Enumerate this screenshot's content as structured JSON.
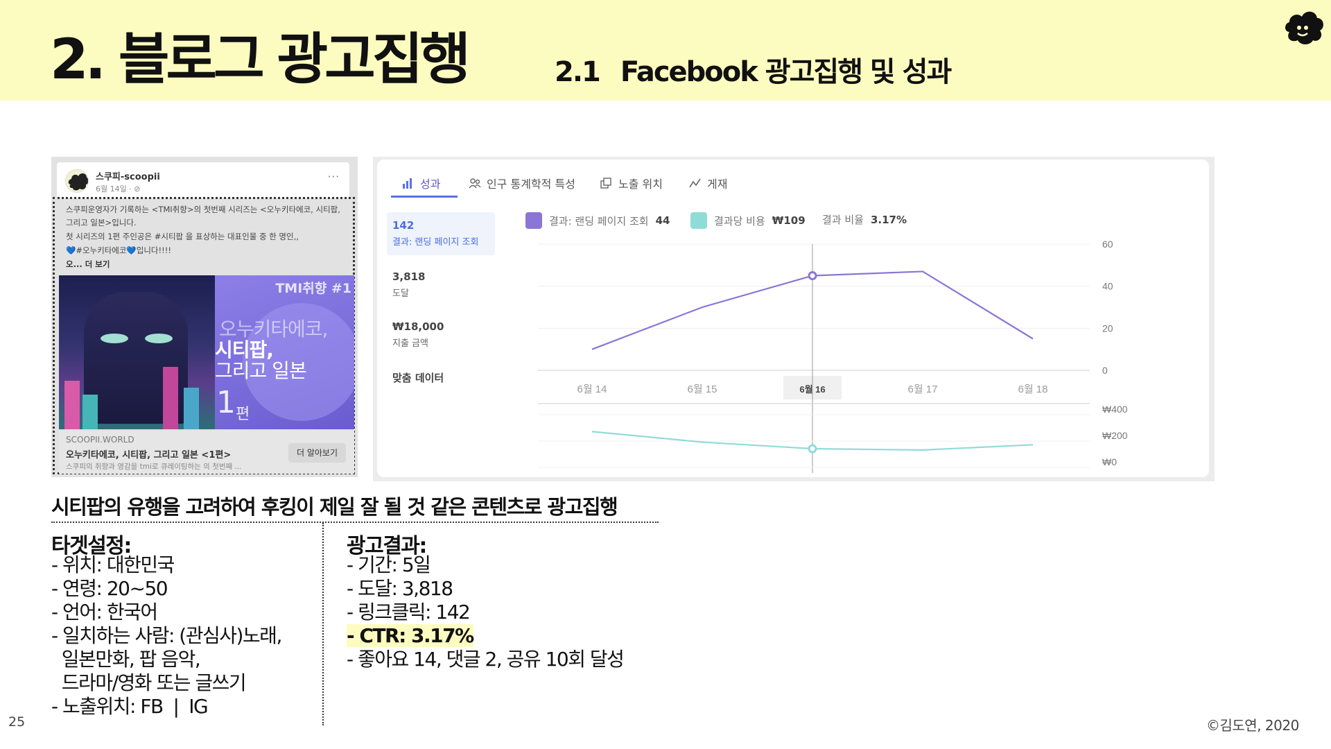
{
  "header": {
    "main_title": "2. 블로그 광고집행",
    "sub_number": "2.1",
    "sub_title": "Facebook 광고집행 및 성과"
  },
  "post": {
    "page_name": "스쿠피-scoopii",
    "date": "6월 14일 · ⊘",
    "more_icon": "···",
    "text_line1": "스쿠피운영자가 기록하는 <TMI취향>의 첫번째 시리즈는 <오누키타에코, 시티팝, 그리고 일본>입니다.",
    "text_line2": "첫 시리즈의 1편 주인공은 #시티팝 을 표상하는 대표인물 중 한 명인,,",
    "text_line3": "💙#오누키타에코💙입니다!!!!",
    "text_more": "오... 더 보기",
    "image_tag": "TMI취향 #1",
    "image_line1": "오누키타에코,",
    "image_line2": "시티팝,",
    "image_line3": "그리고 일본",
    "image_num": "1",
    "image_unit": "편",
    "link_domain": "SCOOPII.WORLD",
    "link_title": "오누키타에코, 시티팝, 그리고 일본 <1편>",
    "link_desc": "스쿠피의 취향과 영감을 tmi로 큐레이팅하는 의 첫번째 ...",
    "link_button": "더 알아보기"
  },
  "insights": {
    "tabs": [
      {
        "label": "성과",
        "icon": "bar-chart-icon"
      },
      {
        "label": "인구 통계학적 특성",
        "icon": "people-icon"
      },
      {
        "label": "노출 위치",
        "icon": "placement-icon"
      },
      {
        "label": "게재",
        "icon": "trend-icon"
      }
    ],
    "metrics": [
      {
        "value": "142",
        "label": "결과: 랜딩 페이지 조회"
      },
      {
        "value": "3,818",
        "label": "도달"
      },
      {
        "value": "₩18,000",
        "label": "지출 금액"
      },
      {
        "value": "맞춤 데이터",
        "label": ""
      }
    ],
    "legend": {
      "result_label": "결과: 랜딩 페이지 조회",
      "result_value": "44",
      "cost_label": "결과당 비용",
      "cost_value": "₩109",
      "rate_label": "결과 비율",
      "rate_value": "3.17%"
    },
    "colors": {
      "result": "#8b75d6",
      "cost": "#8fdcd6",
      "accent": "#5b6fe0"
    }
  },
  "chart_data": [
    {
      "type": "line",
      "x": [
        "6월 14",
        "6월 15",
        "6월 16",
        "6월 17",
        "6월 18"
      ],
      "highlighted_x": "6월 16",
      "series": [
        {
          "name": "결과: 랜딩 페이지 조회",
          "values": [
            10,
            30,
            45,
            47,
            15
          ],
          "color": "#8b75d6"
        }
      ],
      "yticks": [
        "60",
        "40",
        "20",
        "0"
      ],
      "ylim": [
        0,
        60
      ],
      "axis_position": "right"
    },
    {
      "type": "line",
      "x": [
        "6월 14",
        "6월 15",
        "6월 16",
        "6월 17",
        "6월 18"
      ],
      "series": [
        {
          "name": "결과당 비용",
          "values": [
            230,
            150,
            100,
            90,
            130
          ],
          "color": "#8fdcd6"
        }
      ],
      "yticks": [
        "₩400",
        "₩200",
        "₩0"
      ],
      "ylim": [
        0,
        400
      ],
      "axis_position": "right"
    }
  ],
  "summary": {
    "headline": "시티팝의 유행을 고려하여 후킹이 제일 잘 될 것 같은 콘텐츠로 광고집행",
    "target_title": "타겟설정:",
    "target_items": [
      "- 위치: 대한민국",
      "- 연령: 20~50",
      "- 언어: 한국어",
      "- 일치하는 사람: (관심사)노래,",
      "  일본만화, 팝 음악,",
      "  드라마/영화 또는 글쓰기",
      "- 노출위치: FB  |  IG"
    ],
    "result_title": "광고결과:",
    "result_items": [
      "- 기간: 5일",
      "- 도달: 3,818",
      "- 링크클릭: 142",
      "- CTR: 3.17%",
      "- 좋아요 14, 댓글 2, 공유 10회 달성"
    ]
  },
  "footer": {
    "page_number": "25",
    "copyright": "©김도연, 2020"
  }
}
